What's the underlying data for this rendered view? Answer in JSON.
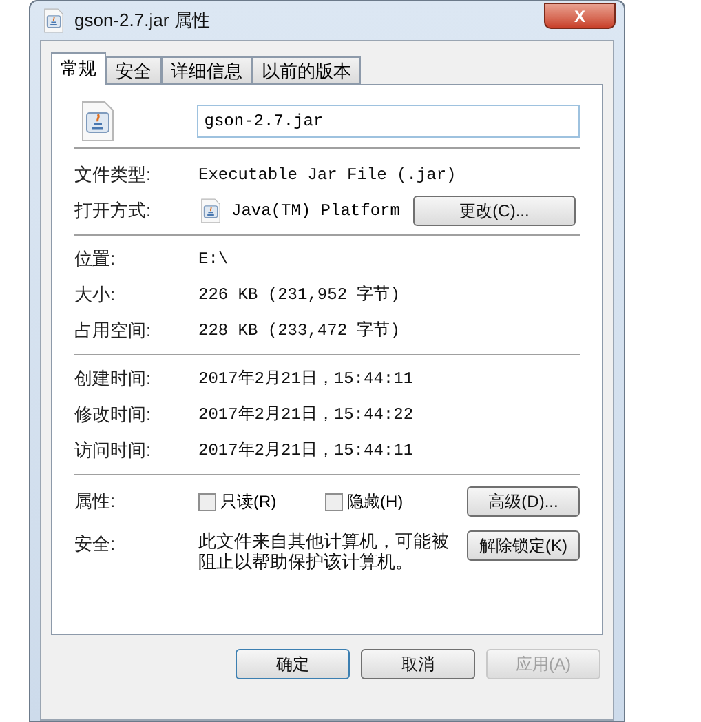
{
  "window": {
    "title": "gson-2.7.jar 属性",
    "close": "X"
  },
  "tabs": [
    {
      "label": "常规",
      "selected": true
    },
    {
      "label": "安全",
      "selected": false
    },
    {
      "label": "详细信息",
      "selected": false
    },
    {
      "label": "以前的版本",
      "selected": false
    }
  ],
  "file_name": {
    "value": "gson-2.7.jar"
  },
  "type_rows": [
    {
      "label": "文件类型:",
      "value": "Executable Jar File (.jar)"
    }
  ],
  "open_with": {
    "label": "打开方式:",
    "value": "Java(TM) Platform",
    "button": "更改(C)..."
  },
  "size_rows": [
    {
      "label": "位置:",
      "value": "E:\\"
    },
    {
      "label": "大小:",
      "value": "226 KB (231,952 字节)"
    },
    {
      "label": "占用空间:",
      "value": "228 KB (233,472 字节)"
    }
  ],
  "time_rows": [
    {
      "label": "创建时间:",
      "value": "2017年2月21日，15:44:11"
    },
    {
      "label": "修改时间:",
      "value": "2017年2月21日，15:44:22"
    },
    {
      "label": "访问时间:",
      "value": "2017年2月21日，15:44:11"
    }
  ],
  "attributes": {
    "label": "属性:",
    "checkboxes": [
      {
        "label": "只读(R)",
        "checked": false
      },
      {
        "label": "隐藏(H)",
        "checked": false
      }
    ],
    "button": "高级(D)..."
  },
  "security": {
    "label": "安全:",
    "text": "此文件来自其他计算机，可能被阻止以帮助保护该计算机。",
    "button": "解除锁定(K)"
  },
  "buttons": [
    {
      "label": "确定",
      "disabled": false,
      "default": true
    },
    {
      "label": "取消",
      "disabled": false,
      "default": false
    },
    {
      "label": "应用(A)",
      "disabled": true,
      "default": false
    }
  ]
}
